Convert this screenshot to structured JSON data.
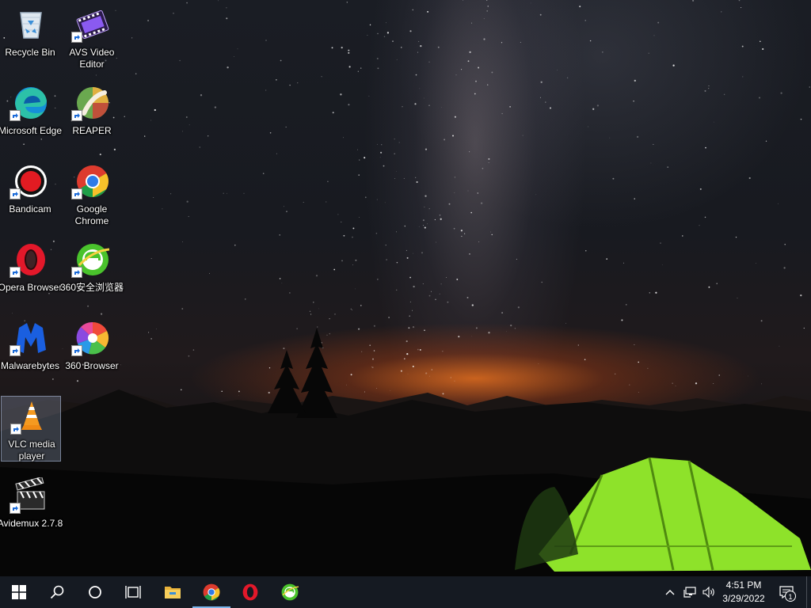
{
  "desktop": {
    "icons": [
      {
        "label": "Recycle Bin"
      },
      {
        "label": "AVS Video Editor"
      },
      {
        "label": "Microsoft Edge"
      },
      {
        "label": "REAPER"
      },
      {
        "label": "Bandicam"
      },
      {
        "label": "Google Chrome"
      },
      {
        "label": "Opera Browser"
      },
      {
        "label": "360安全浏览器"
      },
      {
        "label": "Malwarebytes"
      },
      {
        "label": "360 Browser"
      },
      {
        "label": "VLC media player"
      },
      {
        "label": "Avidemux 2.7.8"
      }
    ],
    "selected_icon": "VLC media player"
  },
  "taskbar": {
    "buttons": [
      {
        "icon": "windows-start-icon"
      },
      {
        "icon": "search-icon"
      },
      {
        "icon": "cortana-icon"
      },
      {
        "icon": "task-view-icon"
      },
      {
        "icon": "file-explorer-icon"
      },
      {
        "icon": "chrome-icon",
        "active": true
      },
      {
        "icon": "opera-icon"
      },
      {
        "icon": "360-browser-icon"
      }
    ],
    "tray": {
      "clock_time": "4:51 PM",
      "clock_date": "3/29/2022",
      "notification_count": "1"
    }
  },
  "colors": {
    "taskbar_bg": "#151a22",
    "taskbar_active_indicator": "#7ab4ea",
    "tent_green": "#8ee22a",
    "horizon_glow": "#e0651e"
  }
}
